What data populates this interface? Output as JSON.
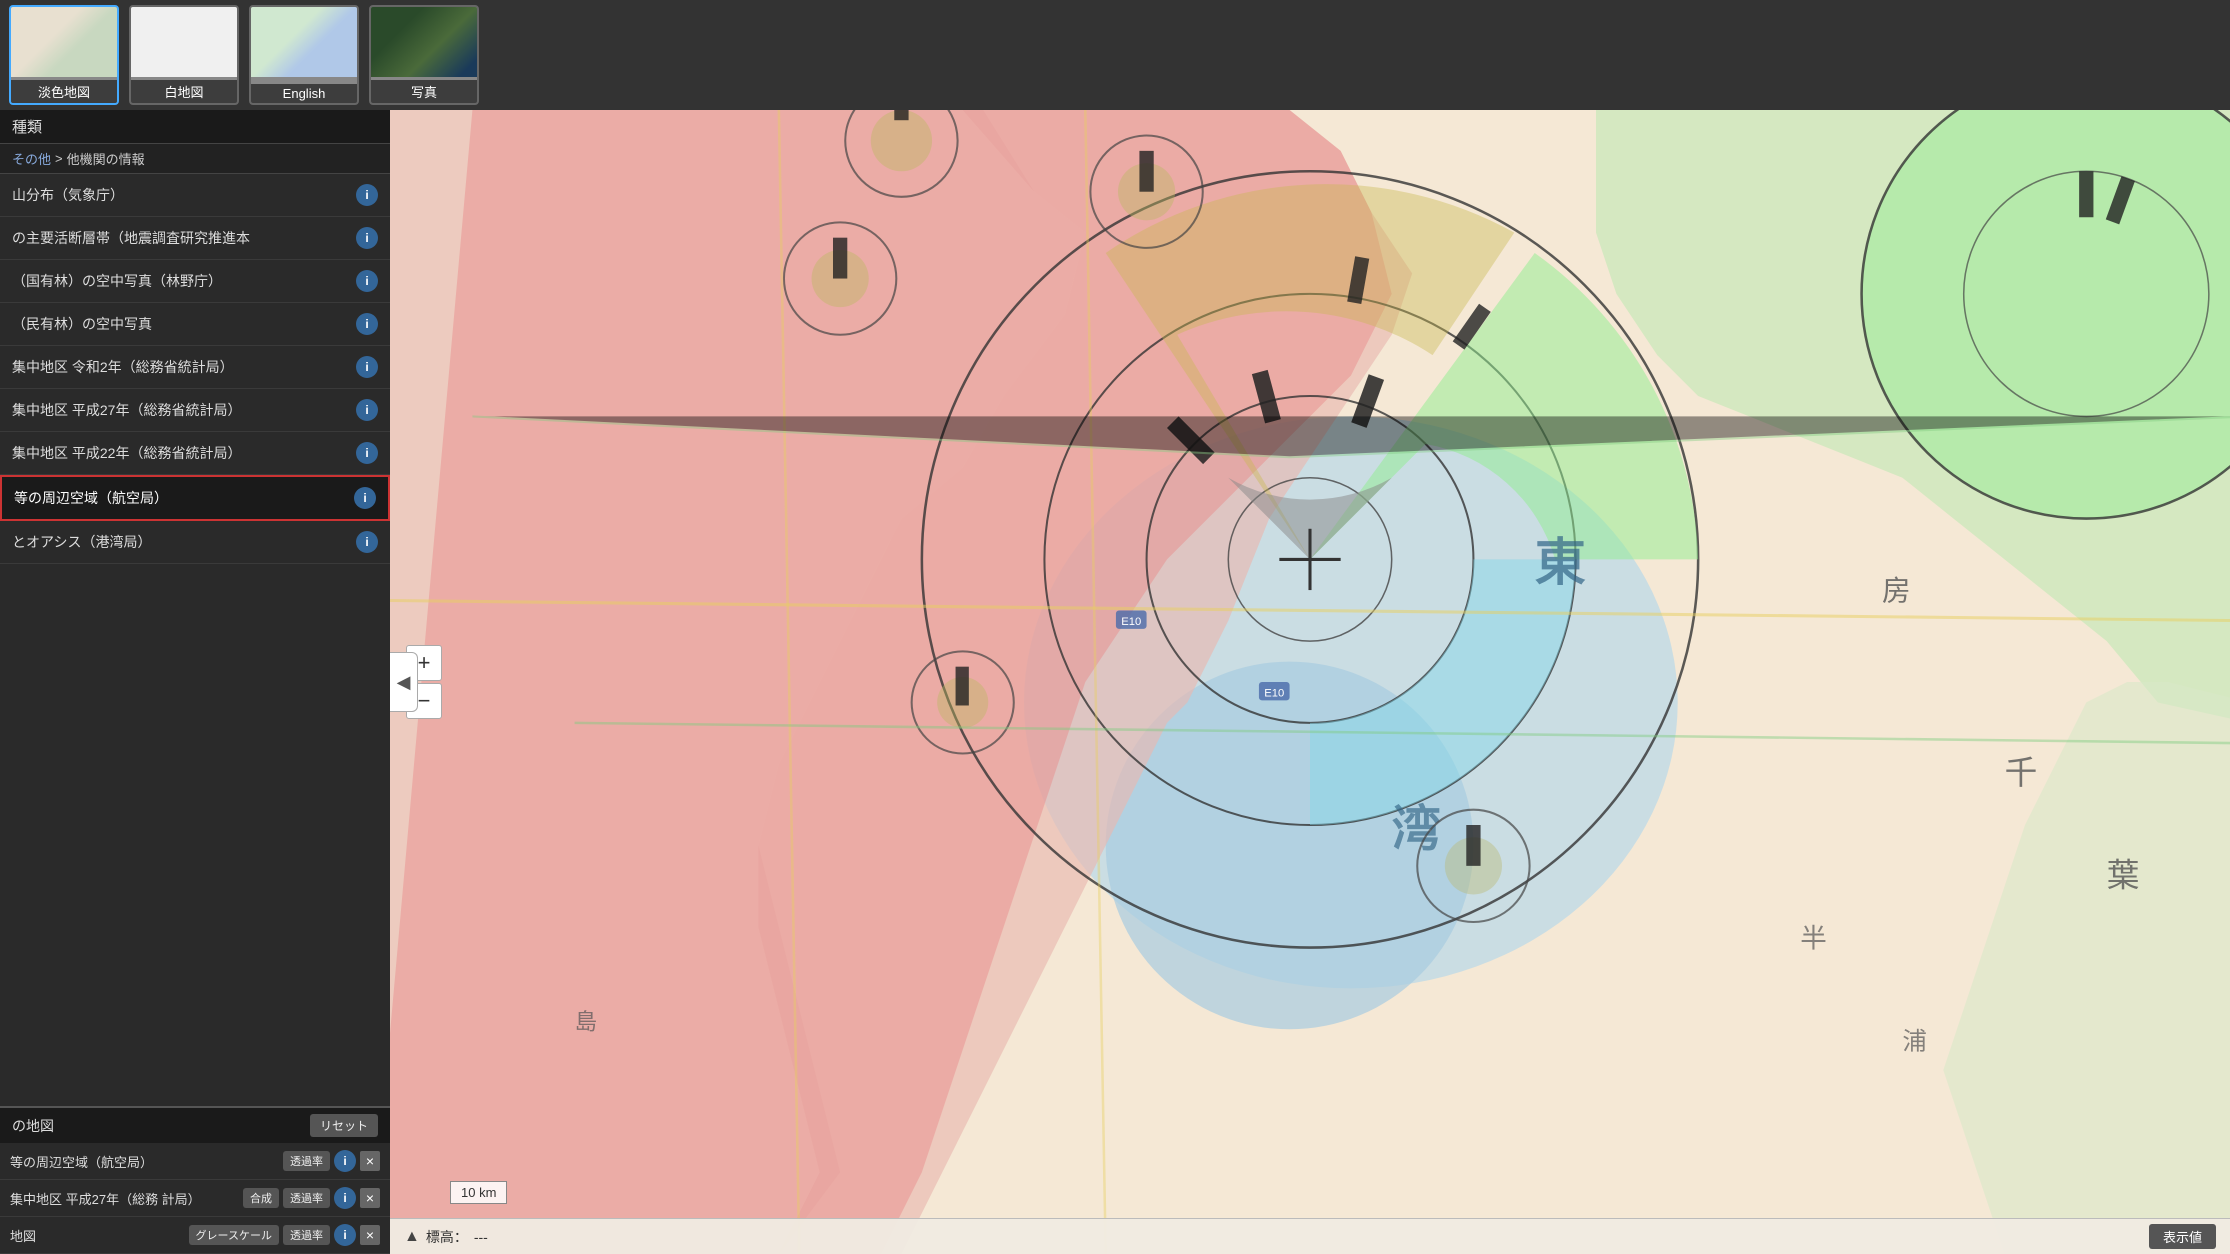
{
  "topBar": {
    "buttons": [
      {
        "id": "tansyoku",
        "label": "淡色地図",
        "preview": "preview-tansyoku",
        "active": true
      },
      {
        "id": "haku",
        "label": "白地図",
        "preview": "preview-haku",
        "active": false
      },
      {
        "id": "english",
        "label": "English",
        "preview": "preview-english",
        "active": false
      },
      {
        "id": "photo",
        "label": "写真",
        "preview": "preview-photo",
        "active": false
      }
    ]
  },
  "sidebar": {
    "sectionTitle": "種類",
    "breadcrumb": {
      "parent": "その他",
      "current": "他機関の情報"
    },
    "layers": [
      {
        "id": "layer1",
        "name": "山分布（気象庁）",
        "highlighted": false
      },
      {
        "id": "layer2",
        "name": "の主要活断層帯（地震調査研究推進本",
        "highlighted": false
      },
      {
        "id": "layer3",
        "name": "（国有林）の空中写真（林野庁）",
        "highlighted": false
      },
      {
        "id": "layer4",
        "name": "（民有林）の空中写真",
        "highlighted": false
      },
      {
        "id": "layer5",
        "name": "集中地区 令和2年（総務省統計局）",
        "highlighted": false
      },
      {
        "id": "layer6",
        "name": "集中地区 平成27年（総務省統計局）",
        "highlighted": false
      },
      {
        "id": "layer7",
        "name": "集中地区 平成22年（総務省統計局）",
        "highlighted": false
      },
      {
        "id": "layer8",
        "name": "等の周辺空域（航空局）",
        "highlighted": true
      },
      {
        "id": "layer9",
        "name": "とオアシス（港湾局）",
        "highlighted": false
      }
    ],
    "activeLayersTitle": "の地図",
    "resetLabel": "リセット",
    "activeLayers": [
      {
        "id": "active1",
        "name": "等の周辺空域（航空局）",
        "controls": [
          "透過率"
        ],
        "hasInfo": true,
        "hasClose": true
      },
      {
        "id": "active2",
        "name": "集中地区 平成27年（総務 計局）",
        "controls": [
          "合成",
          "透過率"
        ],
        "hasInfo": true,
        "hasClose": true
      },
      {
        "id": "active3",
        "name": "地図",
        "controls": [
          "グレースケール",
          "透過率"
        ],
        "hasInfo": true,
        "hasClose": true
      }
    ]
  },
  "map": {
    "scaleLabel": "10 km",
    "collapseArrow": "◀",
    "zoomIn": "+",
    "zoomOut": "−",
    "statusBar": {
      "compassLabel": "▲",
      "elevationLabel": "標高：",
      "elevationValue": "---",
      "displayValueBtn": "表示値"
    }
  },
  "infoIcon": "i"
}
